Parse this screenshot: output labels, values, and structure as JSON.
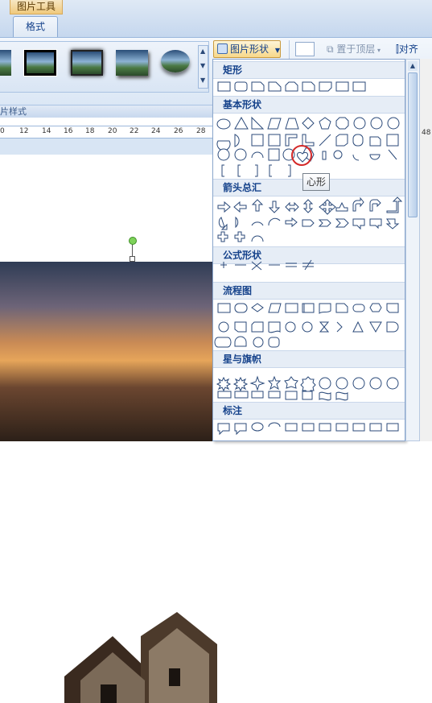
{
  "ribbon": {
    "contextual_tab": "图片工具",
    "format_tab": "格式",
    "picture_shape_button": "图片形状",
    "bring_to_front": "置于顶层",
    "align": "对齐",
    "styles_group_label": "片样式"
  },
  "ruler": {
    "ticks": [
      "0",
      "12",
      "14",
      "16",
      "18",
      "20",
      "22",
      "24",
      "26",
      "28"
    ],
    "right_tick": "48"
  },
  "menu": {
    "sections": [
      "矩形",
      "基本形状",
      "箭头总汇",
      "公式形状",
      "流程图",
      "星与旗帜",
      "标注"
    ]
  },
  "tooltip": "心形",
  "colors": {
    "ribbon_accent": "#15428b",
    "highlight_ring": "#d42828",
    "selection_handle": "#7ed25a"
  }
}
